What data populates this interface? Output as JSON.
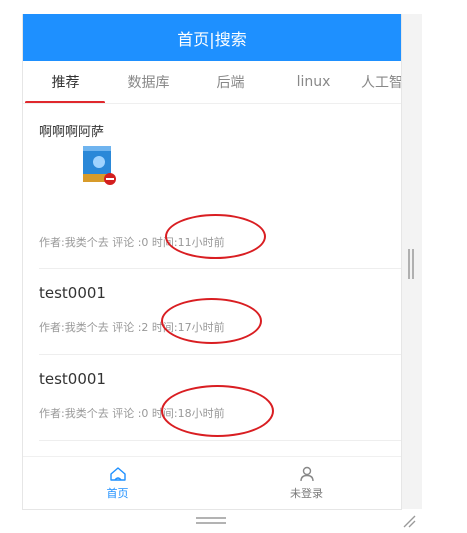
{
  "header": {
    "title": "首页|搜索"
  },
  "tabs": [
    {
      "label": "推荐",
      "active": true
    },
    {
      "label": "数据库",
      "active": false
    },
    {
      "label": "后端",
      "active": false
    },
    {
      "label": "linux",
      "active": false
    },
    {
      "label": "人工智",
      "active": false
    }
  ],
  "posts": [
    {
      "title": "啊啊啊阿萨",
      "meta": "作者:我类个去 评论 :0 时间:11小时前",
      "has_thumbnail": true
    },
    {
      "title": "test0001",
      "meta": "作者:我类个去 评论 :2 时间:17小时前",
      "has_thumbnail": false
    },
    {
      "title": "test0001",
      "meta": "作者:我类个去 评论 :0 时间:18小时前",
      "has_thumbnail": false
    }
  ],
  "cutoff_text": "' ' ' ' ' '",
  "tabbar": {
    "home_label": "首页",
    "login_label": "未登录"
  },
  "colors": {
    "brand": "#1e90ff",
    "tab_indicator": "#e0282d",
    "annotation": "#d91e22"
  }
}
